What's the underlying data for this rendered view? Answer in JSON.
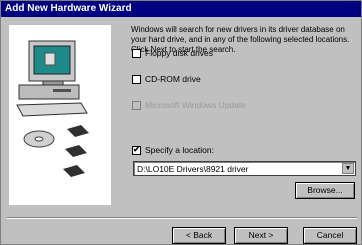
{
  "window": {
    "title": "Add New Hardware Wizard"
  },
  "instructions": "Windows will search for new drivers in its driver database on your hard drive, and in any of the following selected locations. Click Next to start the search.",
  "options": [
    {
      "label": "Floppy disk drives",
      "checked": false,
      "enabled": true
    },
    {
      "label": "CD-ROM drive",
      "checked": false,
      "enabled": true
    },
    {
      "label": "Microsoft Windows Update",
      "checked": false,
      "enabled": false
    },
    {
      "label": "Specify a location:",
      "checked": true,
      "enabled": true
    }
  ],
  "location": {
    "value": "D:\\LO10E Drivers\\8921 driver"
  },
  "buttons": {
    "browse": "Browse...",
    "back": "< Back",
    "next": "Next >",
    "cancel": "Cancel"
  },
  "check_mark": "✔",
  "colors": {
    "titlebar": "#000080",
    "face": "#c0c0c0"
  }
}
